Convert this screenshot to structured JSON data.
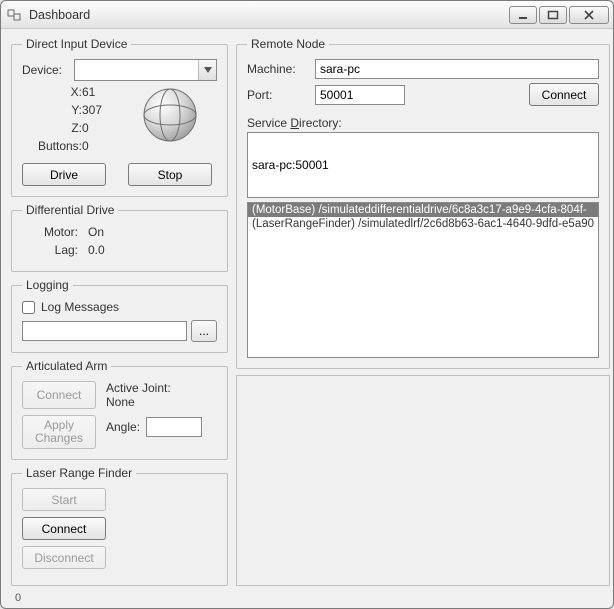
{
  "window": {
    "title": "Dashboard"
  },
  "direct_input": {
    "legend": "Direct Input Device",
    "device_label": "Device:",
    "x_label": "X:",
    "x_value": "61",
    "y_label": "Y:",
    "y_value": "307",
    "z_label": "Z:",
    "z_value": "0",
    "buttons_label": "Buttons:",
    "buttons_value": "0",
    "drive_btn": "Drive",
    "stop_btn": "Stop"
  },
  "diff_drive": {
    "legend": "Differential Drive",
    "motor_label": "Motor:",
    "motor_value": "On",
    "lag_label": "Lag:",
    "lag_value": "0.0"
  },
  "logging": {
    "legend": "Logging",
    "checkbox_label": "Log Messages",
    "browse_btn": "..."
  },
  "arm": {
    "legend": "Articulated Arm",
    "connect_btn": "Connect",
    "apply_btn": "Apply\nChanges",
    "active_joint_label": "Active Joint:",
    "active_joint_value": "None",
    "angle_label": "Angle:"
  },
  "lrf": {
    "legend": "Laser Range Finder",
    "start_btn": "Start",
    "connect_btn": "Connect",
    "disconnect_btn": "Disconnect"
  },
  "remote": {
    "legend": "Remote Node",
    "machine_label": "Machine:",
    "machine_value": "sara-pc",
    "port_label": "Port:",
    "port_value": "50001",
    "connect_btn": "Connect",
    "service_dir_prefix": "Service ",
    "service_dir_underline": "D",
    "service_dir_suffix": "irectory:",
    "service_dir_value": "sara-pc:50001",
    "items": [
      "(MotorBase) /simulateddifferentialdrive/6c8a3c17-a9e9-4cfa-804f-",
      "(LaserRangeFinder) /simulatedlrf/2c6d8b63-6ac1-4640-9dfd-e5a90"
    ]
  },
  "status": {
    "text": "0"
  }
}
